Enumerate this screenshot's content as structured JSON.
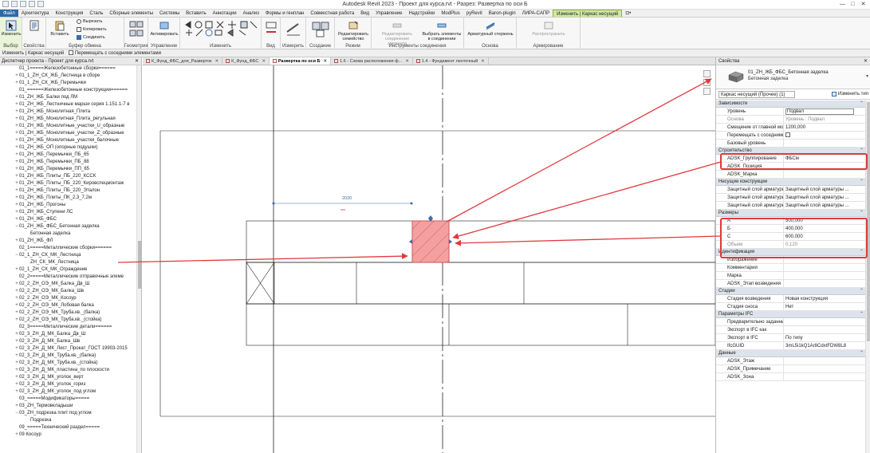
{
  "app": {
    "title": "Autodesk Revit 2023 - Проект для курса.rvt - Разрез: Развертка по оси Б",
    "user_field": "",
    "window_buttons": [
      "—",
      "□",
      "✕"
    ]
  },
  "ribbon_tabs": [
    {
      "label": "Файл",
      "state": "file"
    },
    {
      "label": "Архитектура"
    },
    {
      "label": "Конструкция"
    },
    {
      "label": "Сталь"
    },
    {
      "label": "Сборные элементы"
    },
    {
      "label": "Системы"
    },
    {
      "label": "Вставить"
    },
    {
      "label": "Аннотации"
    },
    {
      "label": "Анализ"
    },
    {
      "label": "Формы и генплан"
    },
    {
      "label": "Совместная работа"
    },
    {
      "label": "Вид"
    },
    {
      "label": "Управление"
    },
    {
      "label": "Надстройки"
    },
    {
      "label": "ModPlus"
    },
    {
      "label": "pyRevit"
    },
    {
      "label": "Baron-plugin"
    },
    {
      "label": "ЛИРА-САПР"
    },
    {
      "label": "Изменить | Каркас несущий",
      "state": "active"
    },
    {
      "label": "⊡•"
    }
  ],
  "ribbon": {
    "modify_label": "Изменить",
    "select_label": "Выбор",
    "properties_label": "Свойства",
    "paste_label": "Вставить",
    "cut_label": "Вырезать",
    "copy_label": "Копировать",
    "match_label": "Соединить",
    "clipboard_label": "Буфер обмена",
    "geometry_label": "Геометрия",
    "activate_label": "Активировать",
    "manage_label": "Управление",
    "modify_group_label": "Изменить",
    "view_label": "Вид",
    "measure_label": "Измерить",
    "create_label": "Создание",
    "edit_family_label": "Редактировать семейство",
    "mode_label": "Режим",
    "edit_joints_label": "Редактировать соединение элемента",
    "select_joints_label": "Выбрать элементы в соединении",
    "connect_tools_label": "Инструменты соединения",
    "rebar_label": "Арматурный стержень",
    "basis_label": "Основа",
    "distribute_label": "Распространить",
    "reinforcement_label": "Армирование"
  },
  "options_bar": {
    "context": "Изменить | Каркас несущий",
    "move_with_nearby": "Перемещать с соседними элементами"
  },
  "browser": {
    "title": "Диспетчер проекта - Проект для курса.rvt",
    "items": [
      {
        "label": "01_1=====Железобетонные сборки======",
        "exp": ""
      },
      {
        "label": "01_1_ZH_СК_ЖБ_Лестница в сборе",
        "exp": "+"
      },
      {
        "label": "01_1_ZH_СК_ЖБ_Перемычки",
        "exp": "+"
      },
      {
        "label": "01_======Железобетонные конструкции======",
        "exp": ""
      },
      {
        "label": "01_ZH_ЖБ_Балки под ЛМ",
        "exp": "+"
      },
      {
        "label": "01_ZH_ЖБ_Лестничные марши серия 1.151.1-7 в",
        "exp": "+"
      },
      {
        "label": "01_ZH_ЖБ_Монолитная_Плита",
        "exp": "+"
      },
      {
        "label": "01_ZH_ЖБ_Монолитная_Плита_регульная",
        "exp": "+"
      },
      {
        "label": "01_ZH_ЖБ_Монолитные_участки_U_образные",
        "exp": "+"
      },
      {
        "label": "01_ZH_ЖБ_Монолитные_участки_Z_образные",
        "exp": "+"
      },
      {
        "label": "01_ZH_ЖБ_Монолитные_участки_балочные",
        "exp": "+"
      },
      {
        "label": "01_ZH_ЖБ_ОП (опорные подушки)",
        "exp": "+"
      },
      {
        "label": "01_ZH_ЖБ_Перемычки_ПБ_65",
        "exp": "+"
      },
      {
        "label": "01_ZH_ЖБ_Перемычки_ПБ_88",
        "exp": "+"
      },
      {
        "label": "01_ZH_ЖБ_Перемычки_ПП_65",
        "exp": "+"
      },
      {
        "label": "01_ZH_ЖБ_Плиты_ПБ_220_КССК",
        "exp": "+"
      },
      {
        "label": "01_ZH_ЖБ_Плиты_ПБ_220_Кировспецмонтаж",
        "exp": "+"
      },
      {
        "label": "01_ZH_ЖБ_Плиты_ПБ_220_Эталон",
        "exp": "+"
      },
      {
        "label": "01_ZH_ЖБ_Плиты_ПК_2,3_7,2м",
        "exp": "+"
      },
      {
        "label": "01_ZH_ЖБ_Прогоны",
        "exp": "+"
      },
      {
        "label": "01_ZH_ЖБ_Ступени ЛС",
        "exp": "+"
      },
      {
        "label": "01_ZH_ЖБ_ФБС",
        "exp": "+"
      },
      {
        "label": "01_ZH_ЖБ_ФБС_Бетонная заделка",
        "exp": "−"
      },
      {
        "label": "Бетонная заделка",
        "exp": "",
        "indent": 1
      },
      {
        "label": "01_ZH_ЖБ_ФЛ",
        "exp": "+"
      },
      {
        "label": "02_1=====Металлические сборки======",
        "exp": ""
      },
      {
        "label": "02_1_ZH_СК_МК_Лестница",
        "exp": "−"
      },
      {
        "label": "ZH_СК_МК_Лестница",
        "exp": "",
        "indent": 1
      },
      {
        "label": "02_1_ZH_СК_МК_Ограждение",
        "exp": "+"
      },
      {
        "label": "02_2=====Металлические отправочные элеме",
        "exp": ""
      },
      {
        "label": "02_2_ZH_ОЭ_МК_Балка_Дв_Ш",
        "exp": "+"
      },
      {
        "label": "02_2_ZH_ОЭ_МК_Балка_Шв",
        "exp": "+"
      },
      {
        "label": "02_2_ZH_ОЭ_МК_Косоур",
        "exp": "+"
      },
      {
        "label": "02_2_ZH_ОЭ_МК_Лобовая балка",
        "exp": "+"
      },
      {
        "label": "02_2_ZH_ОЭ_МК_Труба.кв._(балка)",
        "exp": "+"
      },
      {
        "label": "02_2_ZH_ОЭ_МК_Труба.кв._(стойка)",
        "exp": "+"
      },
      {
        "label": "02_3=====Металлические детали======",
        "exp": ""
      },
      {
        "label": "02_3_ZH_Д_МК_Балка_Дв_Ш",
        "exp": "+"
      },
      {
        "label": "02_3_ZH_Д_МК_Балка_Шв",
        "exp": "+"
      },
      {
        "label": "02_3_ZH_Д_МК_Лист_Прокат_ГОСТ 19903-2015",
        "exp": "+"
      },
      {
        "label": "02_3_ZH_Д_МК_Труба.кв._(балка)",
        "exp": "+"
      },
      {
        "label": "02_3_ZH_Д_МК_Труба.кв._(стойка)",
        "exp": "+"
      },
      {
        "label": "02_3_ZH_Д_МК_пластина_по плоскости",
        "exp": "+"
      },
      {
        "label": "02_3_ZH_Д_МК_уголок_верт",
        "exp": "+"
      },
      {
        "label": "02_3_ZH_Д_МК_уголок_гориз",
        "exp": "+"
      },
      {
        "label": "02_3_ZH_Д_МК_уголок_под углом",
        "exp": "+"
      },
      {
        "label": "03_=====Модификаторы=====",
        "exp": ""
      },
      {
        "label": "03_ZH_Термовкладыши",
        "exp": "+"
      },
      {
        "label": "03_ZH_подрезка плит под углом",
        "exp": "−"
      },
      {
        "label": "Подрезка",
        "exp": "",
        "indent": 1
      },
      {
        "label": "09_=====Технический раздел=====",
        "exp": ""
      },
      {
        "label": "09 Косоур",
        "exp": "+"
      }
    ]
  },
  "view_tabs": [
    {
      "label": "К_Фунд_ФБС_для_Разверток"
    },
    {
      "label": "К_Фунд_ФБС"
    },
    {
      "label": "Развертка по оси Б",
      "active": true
    },
    {
      "label": "1.6 - Схема расположения ф..."
    },
    {
      "label": "1.4 - Фундамент ленточный"
    }
  ],
  "canvas": {
    "dimension_text": "2020"
  },
  "properties": {
    "title": "Свойства",
    "family": "01_ZH_ЖБ_ФБС_Бетонная заделка",
    "type": "Бетонная заделка",
    "instance_selector": "Каркас несущий (Прочее) (1)",
    "edit_type_label": "Изменить тип",
    "groups": [
      {
        "name": "Зависимости",
        "rows": [
          {
            "n": "Уровень",
            "v": "Подвал",
            "box": true
          },
          {
            "n": "Основа",
            "v": "Уровень : Подвал",
            "ro": true
          },
          {
            "n": "Смещение от главной мод...",
            "v": "1200,000"
          },
          {
            "n": "Перемещать с соседними ...",
            "v": "",
            "chk": true
          },
          {
            "n": "Базовый уровень",
            "v": ""
          }
        ]
      },
      {
        "name": "Строительство",
        "rows": [
          {
            "n": "ADSK_Группирование",
            "v": "ФБСм"
          },
          {
            "n": "ADSK_Позиция",
            "v": ""
          },
          {
            "n": "ADSK_Марка",
            "v": ""
          }
        ]
      },
      {
        "name": "Несущие конструкции",
        "rows": [
          {
            "n": "Защитный слой арматуры ...",
            "v": "Защитный слой арматуры ..."
          },
          {
            "n": "Защитный слой арматуры ...",
            "v": "Защитный слой арматуры ..."
          },
          {
            "n": "Защитный слой арматуры ...",
            "v": "Защитный слой арматуры ..."
          }
        ]
      },
      {
        "name": "Размеры",
        "rows": [
          {
            "n": "А",
            "v": "500,000"
          },
          {
            "n": "Б",
            "v": "400,000"
          },
          {
            "n": "С",
            "v": "600,000"
          },
          {
            "n": "Объем",
            "v": "0,120",
            "ro": true
          }
        ]
      },
      {
        "name": "Идентификация",
        "rows": [
          {
            "n": "Изображение",
            "v": ""
          },
          {
            "n": "Комментарии",
            "v": ""
          },
          {
            "n": "Марка",
            "v": ""
          },
          {
            "n": "ADSK_Этап возведения",
            "v": ""
          }
        ]
      },
      {
        "name": "Стадии",
        "rows": [
          {
            "n": "Стадия возведения",
            "v": "Новая конструкция"
          },
          {
            "n": "Стадия сноса",
            "v": "Нет"
          }
        ]
      },
      {
        "name": "Параметры IFC",
        "rows": [
          {
            "n": "Предварительно заданны...",
            "v": ""
          },
          {
            "n": "Экспорт в IFC как",
            "v": ""
          },
          {
            "n": "Экспорт в IFC",
            "v": "По типу"
          },
          {
            "n": "IfcGUID",
            "v": "3mL5i1kQ1Ar8CdxtFDW8L8"
          }
        ]
      },
      {
        "name": "Данные",
        "rows": [
          {
            "n": "ADSK_Этаж",
            "v": ""
          },
          {
            "n": "ADSK_Примечание",
            "v": ""
          },
          {
            "n": "ADSK_Зона",
            "v": ""
          }
        ]
      }
    ]
  },
  "colors": {
    "accent_red": "#e0393e",
    "element_fill": "#f4a0a0",
    "context_tab": "#cfe8a3",
    "file_tab": "#2c6aa8"
  }
}
